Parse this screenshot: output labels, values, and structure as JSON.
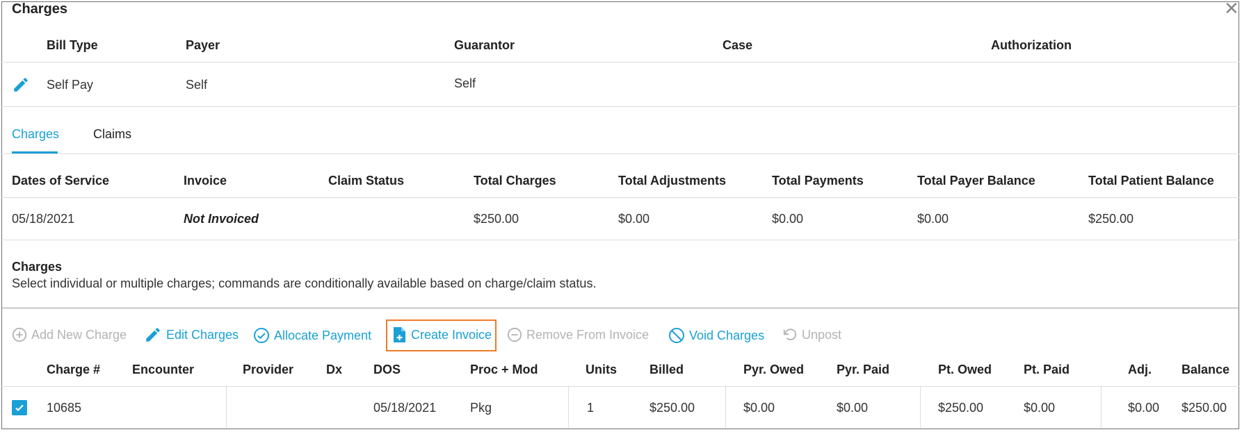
{
  "dialog": {
    "title": "Charges"
  },
  "billing_header": {
    "columns": [
      "Bill Type",
      "Payer",
      "Guarantor",
      "Case",
      "Authorization"
    ],
    "row": {
      "bill_type": "Self Pay",
      "payer": "Self",
      "guarantor": "Self"
    }
  },
  "tabs": [
    {
      "label": "Charges",
      "active": true
    },
    {
      "label": "Claims",
      "active": false
    }
  ],
  "summary": {
    "columns": [
      "Dates of Service",
      "Invoice",
      "Claim Status",
      "Total Charges",
      "Total Adjustments",
      "Total Payments",
      "Total Payer Balance",
      "Total Patient Balance"
    ],
    "row": {
      "dates_of_service": "05/18/2021",
      "invoice": "Not Invoiced",
      "claim_status": "",
      "total_charges": "$250.00",
      "total_adjustments": "$0.00",
      "total_payments": "$0.00",
      "total_payer_balance": "$0.00",
      "total_patient_balance": "$250.00"
    }
  },
  "charges_section": {
    "title": "Charges",
    "subtitle": "Select individual or multiple charges; commands are conditionally available based on charge/claim status."
  },
  "toolbar": {
    "add_new_charge": "Add New Charge",
    "edit_charges": "Edit Charges",
    "allocate_payment": "Allocate Payment",
    "create_invoice": "Create Invoice",
    "remove_from_invoice": "Remove From Invoice",
    "void_charges": "Void Charges",
    "unpost": "Unpost"
  },
  "charges_table": {
    "columns": [
      "Charge #",
      "Encounter",
      "Provider",
      "Dx",
      "DOS",
      "Proc + Mod",
      "Units",
      "Billed",
      "Pyr. Owed",
      "Pyr. Paid",
      "Pt. Owed",
      "Pt. Paid",
      "Adj.",
      "Balance"
    ],
    "rows": [
      {
        "selected": true,
        "charge_no": "10685",
        "encounter": "",
        "provider": "",
        "dx": "",
        "dos": "05/18/2021",
        "proc_mod": "Pkg",
        "units": "1",
        "billed": "$250.00",
        "pyr_owed": "$0.00",
        "pyr_paid": "$0.00",
        "pt_owed": "$250.00",
        "pt_paid": "$0.00",
        "adj": "$0.00",
        "balance": "$250.00"
      }
    ]
  },
  "colors": {
    "accent": "#1aa0d6",
    "highlight": "#ef7a28",
    "disabled": "#b3b3b3"
  }
}
